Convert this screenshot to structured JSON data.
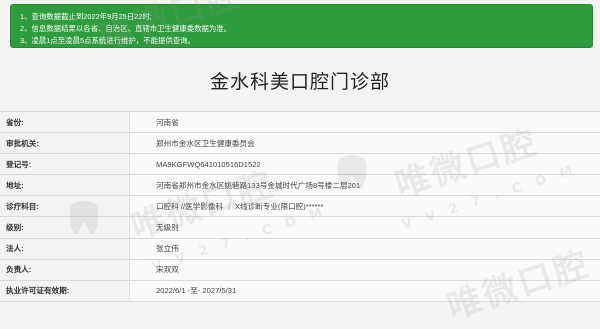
{
  "notice": {
    "lines": [
      "1、查询数据截止到2022年9月25日22时;",
      "2、信息数据结果以各省、自治区、直辖市卫生健康委数据为准。",
      "3、凌晨1点至凌晨5点系统进行维护，不能提供查询。"
    ],
    "close_label": "×"
  },
  "title": "金水科美口腔门诊部",
  "rows": [
    {
      "label": "省份:",
      "value": "河南省"
    },
    {
      "label": "审批机关:",
      "value": "郑州市金水区卫生健康委员会"
    },
    {
      "label": "登记号:",
      "value": "MA9KGFWQ641010516D1522"
    },
    {
      "label": "地址:",
      "value": "河南省郑州市金水区姚砦路133号金城时代广场8号楼二层201"
    },
    {
      "label": "诊疗科目:",
      "value": "口腔科 //医学影像科 ｜ X线诊断专业(限口腔)******"
    },
    {
      "label": "级别:",
      "value": "无级别"
    },
    {
      "label": "法人:",
      "value": "张立伟"
    },
    {
      "label": "负责人:",
      "value": "宋双双"
    },
    {
      "label": "执业许可证有效期:",
      "value": "2022/6/1 -至- 2027/5/31"
    }
  ],
  "watermark": {
    "text": "唯微口腔",
    "sub": "V V 2 7 . C O M"
  },
  "colors": {
    "notice_bg": "#2e9c3c",
    "notice_text": "#ffffff"
  }
}
